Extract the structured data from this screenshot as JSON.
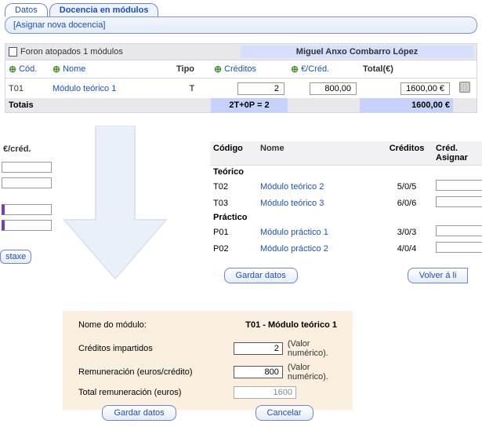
{
  "tabs": {
    "datos": "Datos",
    "docencia": "Docencia en módulos"
  },
  "subbar": {
    "link": "[Asignar nova docencia]"
  },
  "top_table": {
    "found_text": "Foron atopados 1 módulos",
    "person": "Miguel Anxo Combarro López",
    "headers": {
      "cod": "Cód.",
      "nome": "Nome",
      "tipo": "Tipo",
      "creditos": "Créditos",
      "eurcred": "€/Créd.",
      "total": "Total(€)"
    },
    "row": {
      "cod": "T01",
      "nome": "Módulo teórico 1",
      "tipo": "T",
      "creditos": "2",
      "eurcred": "800,00",
      "total": "1600,00 €"
    },
    "totals": {
      "label": "Totais",
      "formula": "2T+0P = 2",
      "total": "1600,00 €"
    }
  },
  "left_strip": {
    "header": "€/créd.",
    "btn_frag": "staxe"
  },
  "mod_list": {
    "headers": {
      "codigo": "Código",
      "nome": "Nome",
      "creditos": "Créditos",
      "asignar": "Créd. Asignar"
    },
    "teorico_label": "Teórico",
    "practico_label": "Práctico",
    "teorico": [
      {
        "cod": "T02",
        "nome": "Módulo teórico 2",
        "cred": "5/0/5"
      },
      {
        "cod": "T03",
        "nome": "Módulo teórico 3",
        "cred": "6/0/6"
      }
    ],
    "practico": [
      {
        "cod": "P01",
        "nome": "Módulo práctico 1",
        "cred": "3/0/3"
      },
      {
        "cod": "P02",
        "nome": "Módulo práctico 2",
        "cred": "4/0/4"
      }
    ],
    "btn_gardar": "Gardar datos",
    "btn_volver": "Volver á li"
  },
  "form": {
    "label_nome": "Nome do módulo:",
    "value_nome": "T01 - Módulo teórico 1",
    "label_cred": "Créditos impartidos",
    "value_cred": "2",
    "label_rem": "Remuneración (euros/crédito)",
    "value_rem": "800",
    "label_total": "Total remuneración (euros)",
    "value_total": "1600",
    "hint": "(Valor numérico).",
    "btn_gardar": "Gardar datos",
    "btn_cancelar": "Cancelar"
  },
  "chart_data": {
    "type": "table",
    "modules_summary": [
      {
        "cod": "T01",
        "nome": "Módulo teórico 1",
        "tipo": "T",
        "creditos": 2,
        "eur_por_credito": 800.0,
        "total_eur": 1600.0
      }
    ],
    "totals": {
      "creditos_teoricos": 2,
      "creditos_practicos": 0,
      "total_eur": 1600.0
    },
    "available_modules": [
      {
        "cod": "T02",
        "nome": "Módulo teórico 2",
        "credits_ratio": "5/0/5"
      },
      {
        "cod": "T03",
        "nome": "Módulo teórico 3",
        "credits_ratio": "6/0/6"
      },
      {
        "cod": "P01",
        "nome": "Módulo práctico 1",
        "credits_ratio": "3/0/3"
      },
      {
        "cod": "P02",
        "nome": "Módulo práctico 2",
        "credits_ratio": "4/0/4"
      }
    ]
  }
}
